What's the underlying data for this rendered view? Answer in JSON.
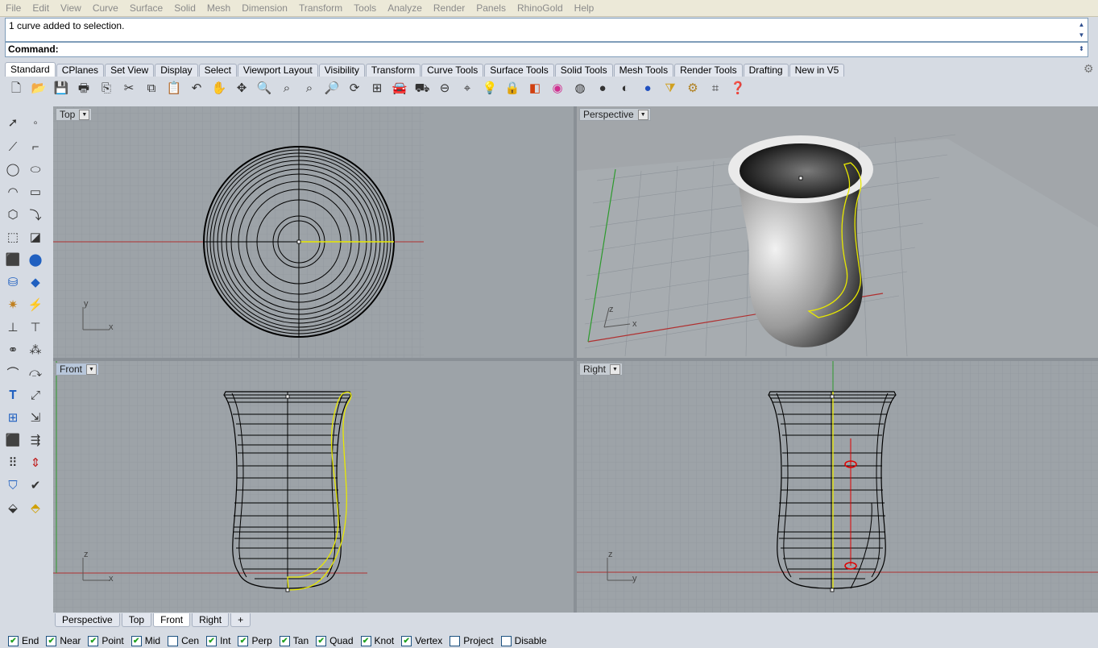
{
  "menu": [
    "File",
    "Edit",
    "View",
    "Curve",
    "Surface",
    "Solid",
    "Mesh",
    "Dimension",
    "Transform",
    "Tools",
    "Analyze",
    "Render",
    "Panels",
    "RhinoGold",
    "Help"
  ],
  "command": {
    "history": "1 curve added to selection.",
    "prompt": "Command:"
  },
  "toolbar_tabs": [
    {
      "label": "Standard",
      "active": true
    },
    {
      "label": "CPlanes"
    },
    {
      "label": "Set View"
    },
    {
      "label": "Display"
    },
    {
      "label": "Select"
    },
    {
      "label": "Viewport Layout"
    },
    {
      "label": "Visibility"
    },
    {
      "label": "Transform"
    },
    {
      "label": "Curve Tools"
    },
    {
      "label": "Surface Tools"
    },
    {
      "label": "Solid Tools"
    },
    {
      "label": "Mesh Tools"
    },
    {
      "label": "Render Tools"
    },
    {
      "label": "Drafting"
    },
    {
      "label": "New in V5"
    }
  ],
  "standard_tools": [
    "new-icon",
    "open-icon",
    "save-icon",
    "print-icon",
    "import-icon",
    "cut-icon",
    "copy-icon",
    "paste-icon",
    "undo-icon",
    "pan-hand-icon",
    "rotate-view-icon",
    "zoom-icon",
    "zoom-window-icon",
    "zoom-extents-icon",
    "zoom-selected-icon",
    "rotate-icon",
    "four-viewports-icon",
    "car-icon",
    "ghosted-icon",
    "object-snap-icon",
    "cplane-icon",
    "light-icon",
    "lock-icon",
    "layer-icon",
    "color-wheel-icon",
    "wireframe-sphere-icon",
    "shaded-sphere-icon",
    "rendered-sphere-icon",
    "render-icon",
    "filter-icon",
    "options-gear-icon",
    "crop-icon",
    "help-icon"
  ],
  "viewports": {
    "top": "Top",
    "perspective": "Perspective",
    "front": "Front",
    "right": "Right"
  },
  "axis": {
    "x": "x",
    "y": "y",
    "z": "z"
  },
  "bottom_tabs": [
    {
      "label": "Perspective"
    },
    {
      "label": "Top"
    },
    {
      "label": "Front",
      "active": true
    },
    {
      "label": "Right"
    }
  ],
  "add_tab": "+",
  "osnaps": [
    {
      "label": "End",
      "checked": true
    },
    {
      "label": "Near",
      "checked": true
    },
    {
      "label": "Point",
      "checked": true
    },
    {
      "label": "Mid",
      "checked": true
    },
    {
      "label": "Cen",
      "checked": false
    },
    {
      "label": "Int",
      "checked": true
    },
    {
      "label": "Perp",
      "checked": true
    },
    {
      "label": "Tan",
      "checked": true
    },
    {
      "label": "Quad",
      "checked": true
    },
    {
      "label": "Knot",
      "checked": true
    },
    {
      "label": "Vertex",
      "checked": true
    },
    {
      "label": "Project",
      "checked": false
    },
    {
      "label": "Disable",
      "checked": false
    }
  ],
  "colors": {
    "grid_major": "#7d8389",
    "grid_minor": "#8f959a",
    "x_axis": "#b03030",
    "y_axis": "#2d9a2d",
    "selection": "#e8e800",
    "control_point": "#e00000",
    "viewport_bg": "#9da3a8"
  }
}
